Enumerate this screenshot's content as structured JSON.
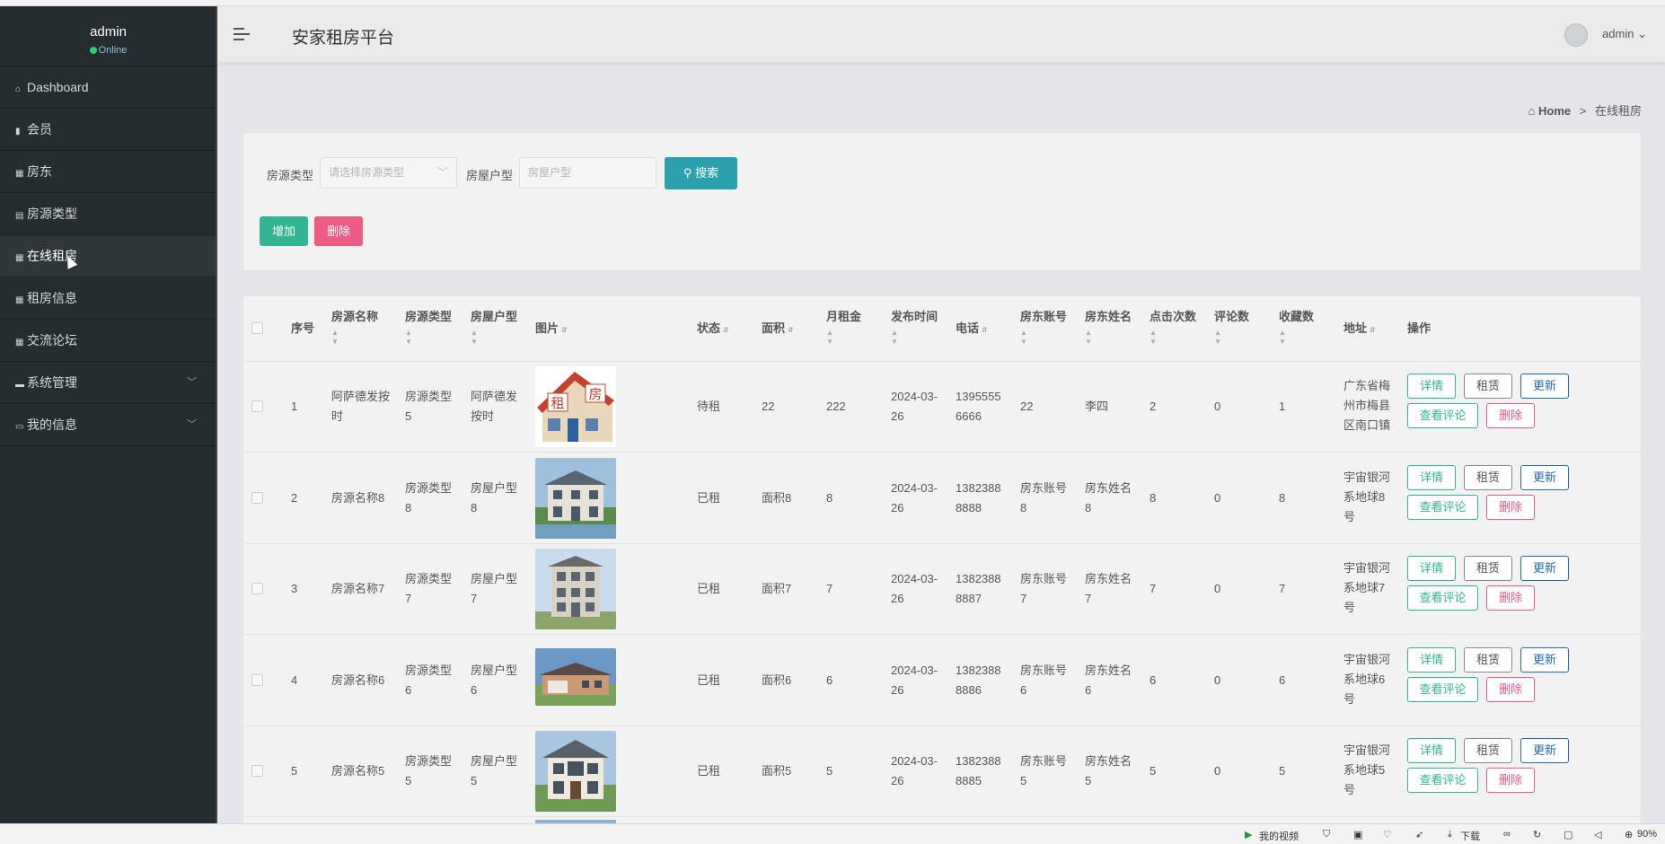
{
  "app": {
    "title": "安家租房平台"
  },
  "sidebar": {
    "username": "admin",
    "status": "Online",
    "items": [
      {
        "label": "Dashboard",
        "icon": "home-icon"
      },
      {
        "label": "会员",
        "icon": "bar-chart-icon"
      },
      {
        "label": "房东",
        "icon": "grid-icon"
      },
      {
        "label": "房源类型",
        "icon": "clipboard-icon"
      },
      {
        "label": "在线租房",
        "icon": "grid-icon",
        "active": true
      },
      {
        "label": "租房信息",
        "icon": "grid-icon"
      },
      {
        "label": "交流论坛",
        "icon": "grid-icon"
      },
      {
        "label": "系统管理",
        "icon": "comment-icon",
        "expandable": true
      },
      {
        "label": "我的信息",
        "icon": "card-icon",
        "expandable": true
      }
    ]
  },
  "header": {
    "user": "admin"
  },
  "breadcrumb": {
    "home": "Home",
    "sep": ">",
    "current": "在线租房"
  },
  "search": {
    "type_label": "房源类型",
    "type_placeholder": "请选择房源类型",
    "layout_label": "房屋户型",
    "layout_placeholder": "房屋户型",
    "search_button": "搜索"
  },
  "actions": {
    "add": "增加",
    "delete": "删除"
  },
  "table": {
    "columns": [
      "序号",
      "房源名称",
      "房源类型",
      "房屋户型",
      "图片",
      "状态",
      "面积",
      "月租金",
      "发布时间",
      "电话",
      "房东账号",
      "房东姓名",
      "点击次数",
      "评论数",
      "收藏数",
      "地址",
      "操作"
    ],
    "op_labels": {
      "detail": "详情",
      "rent": "租赁",
      "update": "更新",
      "review": "查看评论",
      "remove": "删除"
    },
    "rows": [
      {
        "no": "1",
        "name": "阿萨德发按时",
        "type": "房源类型5",
        "layout": "阿萨德发按时",
        "status": "待租",
        "area": "22",
        "rent": "222",
        "date": "2024-03-26",
        "phone": "13955556666",
        "account": "22",
        "owner": "李四",
        "clicks": "2",
        "comments": "0",
        "favs": "1",
        "addr": "广东省梅州市梅县区南口镇"
      },
      {
        "no": "2",
        "name": "房源名称8",
        "type": "房源类型8",
        "layout": "房屋户型8",
        "status": "已租",
        "area": "面积8",
        "rent": "8",
        "date": "2024-03-26",
        "phone": "13823888888",
        "account": "房东账号8",
        "owner": "房东姓名8",
        "clicks": "8",
        "comments": "0",
        "favs": "8",
        "addr": "宇宙银河系地球8号"
      },
      {
        "no": "3",
        "name": "房源名称7",
        "type": "房源类型7",
        "layout": "房屋户型7",
        "status": "已租",
        "area": "面积7",
        "rent": "7",
        "date": "2024-03-26",
        "phone": "13823888887",
        "account": "房东账号7",
        "owner": "房东姓名7",
        "clicks": "7",
        "comments": "0",
        "favs": "7",
        "addr": "宇宙银河系地球7号"
      },
      {
        "no": "4",
        "name": "房源名称6",
        "type": "房源类型6",
        "layout": "房屋户型6",
        "status": "已租",
        "area": "面积6",
        "rent": "6",
        "date": "2024-03-26",
        "phone": "13823888886",
        "account": "房东账号6",
        "owner": "房东姓名6",
        "clicks": "6",
        "comments": "0",
        "favs": "6",
        "addr": "宇宙银河系地球6号"
      },
      {
        "no": "5",
        "name": "房源名称5",
        "type": "房源类型5",
        "layout": "房屋户型5",
        "status": "已租",
        "area": "面积5",
        "rent": "5",
        "date": "2024-03-26",
        "phone": "13823888885",
        "account": "房东账号5",
        "owner": "房东姓名5",
        "clicks": "5",
        "comments": "0",
        "favs": "5",
        "addr": "宇宙银河系地球5号"
      }
    ]
  },
  "statusbar": {
    "video": "我的视频",
    "download": "下载",
    "zoom": "90%"
  }
}
